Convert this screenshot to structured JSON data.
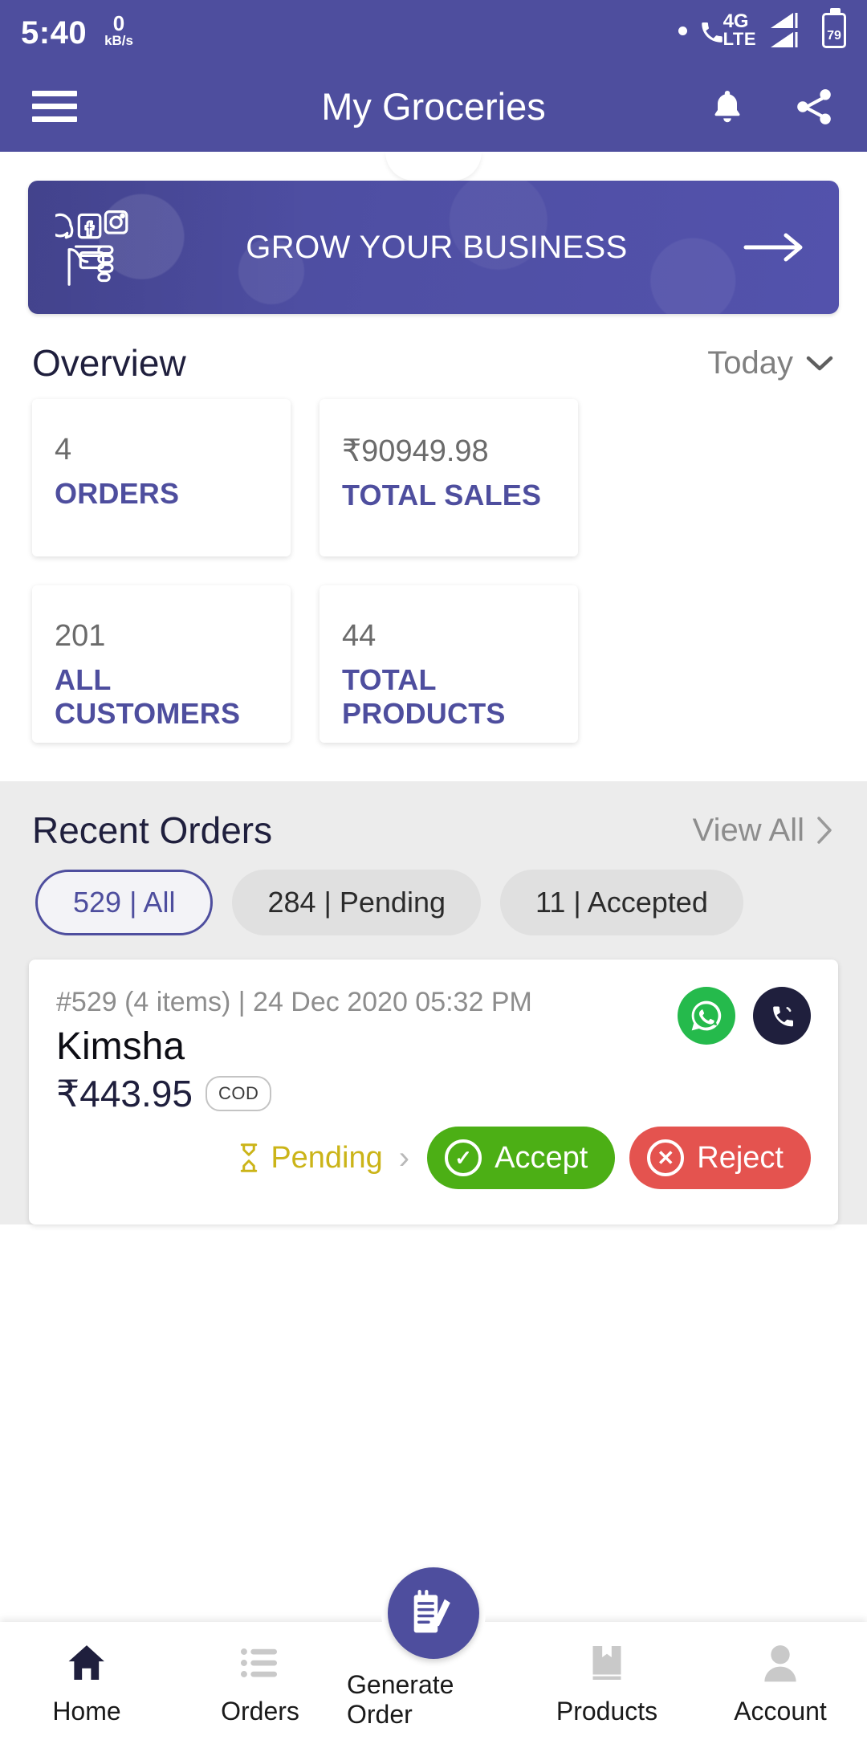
{
  "status_bar": {
    "time": "5:40",
    "net_speed_value": "0",
    "net_speed_unit": "kB/s",
    "network_type": "4G",
    "network_sub": "LTE",
    "battery_level": "79",
    "icons": [
      "dot-icon",
      "phone-4g-icon",
      "signal-bars-icon",
      "battery-icon"
    ]
  },
  "app_bar": {
    "title": "My Groceries",
    "menu_icon": "hamburger-menu-icon",
    "notification_icon": "bell-icon",
    "share_icon": "share-icon"
  },
  "banner": {
    "text": "GROW YOUR BUSINESS",
    "icon": "social-marketing-icon",
    "arrow": "arrow-right-icon"
  },
  "overview": {
    "title": "Overview",
    "period": "Today",
    "period_chevron": "chevron-down-icon",
    "cards": [
      {
        "value": "4",
        "label": "ORDERS"
      },
      {
        "value": "₹90949.98",
        "label": "TOTAL SALES"
      },
      {
        "value": "201",
        "label": "ALL CUSTOMERS"
      },
      {
        "value": "44",
        "label": "TOTAL PRODUCTS"
      }
    ]
  },
  "recent_orders": {
    "title": "Recent Orders",
    "view_all": "View All",
    "view_all_chevron": "chevron-right-icon",
    "filters": [
      {
        "label": "529 | All",
        "active": true
      },
      {
        "label": "284 | Pending",
        "active": false
      },
      {
        "label": "11 | Accepted",
        "active": false
      }
    ],
    "order": {
      "meta": "#529 (4 items) | 24 Dec 2020 05:32 PM",
      "customer": "Kimsha",
      "price": "₹443.95",
      "payment_badge": "COD",
      "whatsapp_icon": "whatsapp-icon",
      "call_icon": "phone-call-icon",
      "status": "Pending",
      "status_icon": "hourglass-icon",
      "status_chevron": "chevron-right-icon",
      "accept_label": "Accept",
      "accept_icon": "check-circle-icon",
      "reject_label": "Reject",
      "reject_icon": "x-circle-icon"
    }
  },
  "bottom_nav": {
    "items": [
      {
        "label": "Home",
        "icon": "home-icon",
        "active": true
      },
      {
        "label": "Orders",
        "icon": "list-icon",
        "active": false
      },
      {
        "label": "Generate Order",
        "icon": "notepad-pencil-icon",
        "active": false
      },
      {
        "label": "Products",
        "icon": "box-icon",
        "active": false
      },
      {
        "label": "Account",
        "icon": "person-icon",
        "active": false
      }
    ]
  },
  "colors": {
    "brand_purple": "#4e4e9e",
    "accept_green": "#4caf15",
    "reject_red": "#e4534f",
    "pending_yellow": "#cbb418",
    "section_bg": "#ececec"
  }
}
